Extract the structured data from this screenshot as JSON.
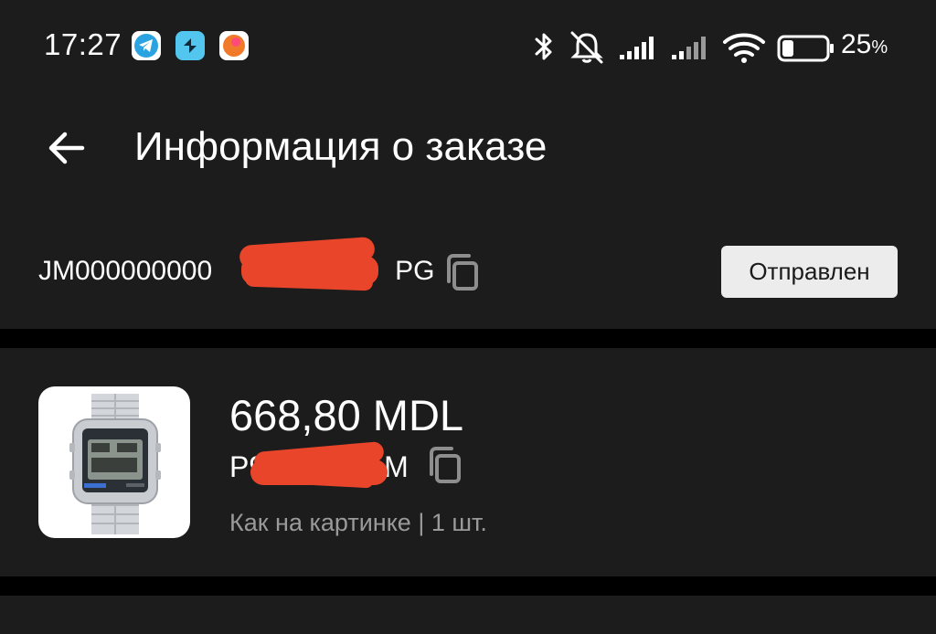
{
  "status_bar": {
    "time": "17:27",
    "notification_icons": [
      "telegram-icon",
      "shortcut-app-icon",
      "orange-app-icon"
    ],
    "system_icons": [
      "bluetooth-icon",
      "mute-icon",
      "signal-icon",
      "signal-icon",
      "wifi-icon",
      "battery-icon"
    ],
    "battery_percent": "25",
    "battery_sign": "%",
    "battery_level": 0.25
  },
  "header": {
    "back_icon": "arrow-left-icon",
    "title": "Информация о заказе"
  },
  "order": {
    "id_prefix": "JM000000000",
    "id_suffix": "PG",
    "copy_icon": "copy-icon",
    "status": "Отправлен"
  },
  "product": {
    "price": "668,80 MDL",
    "sku_prefix": "P9",
    "sku_suffix": "M",
    "copy_icon": "copy-icon",
    "variant": "Как на картинке | 1 шт."
  },
  "colors": {
    "background": "#000000",
    "surface": "#1c1c1c",
    "badge": "#ececec",
    "redaction": "#e8452a",
    "secondary_text": "#9a9a9a"
  }
}
